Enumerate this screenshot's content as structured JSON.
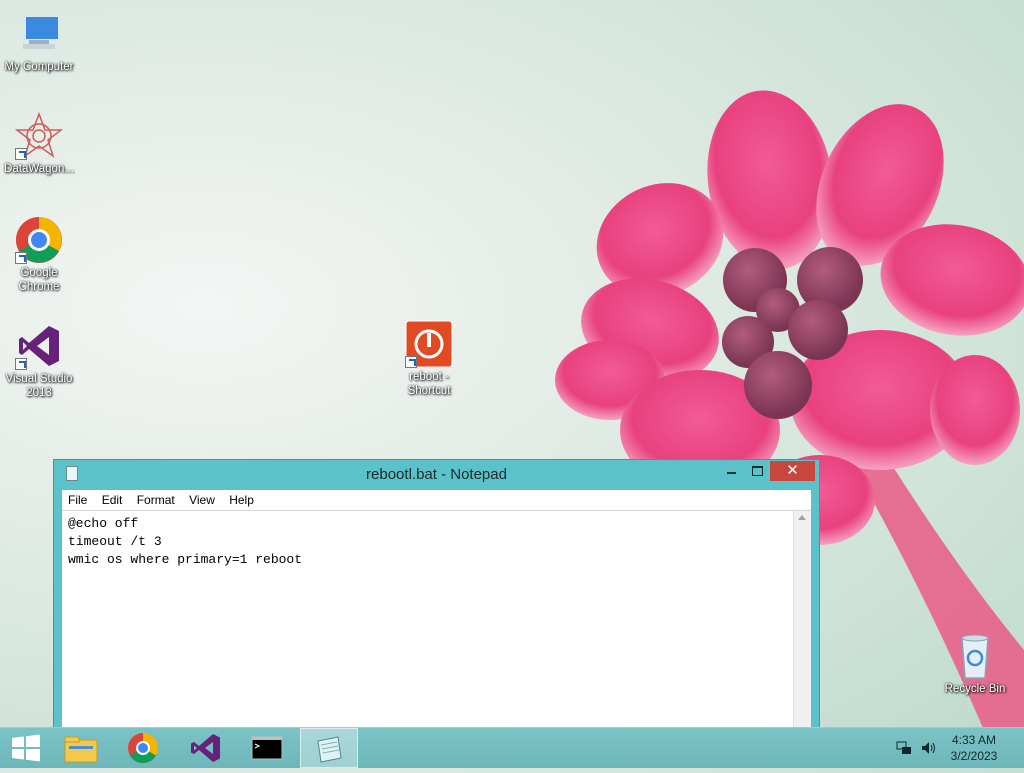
{
  "desktop": {
    "icons": [
      {
        "label": "My Computer",
        "icon": "computer-icon"
      },
      {
        "label": "DataWagon...",
        "icon": "datawagon-icon"
      },
      {
        "label": "Google Chrome",
        "icon": "chrome-icon"
      },
      {
        "label": "Visual Studio 2013",
        "icon": "visual-studio-icon"
      },
      {
        "label": "reboot - Shortcut",
        "icon": "power-icon"
      },
      {
        "label": "Recycle Bin",
        "icon": "recycle-bin-icon"
      }
    ]
  },
  "notepad": {
    "title": "rebootl.bat - Notepad",
    "close_glyph": "✕",
    "menu": [
      "File",
      "Edit",
      "Format",
      "View",
      "Help"
    ],
    "content": "@echo off\ntimeout /t 3\nwmic os where primary=1 reboot"
  },
  "taskbar": {
    "items": [
      "start-icon",
      "file-explorer-icon",
      "chrome-icon",
      "visual-studio-icon",
      "command-prompt-icon",
      "notepad-icon"
    ],
    "clock": {
      "time": "4:33 AM",
      "date": "3/2/2023"
    }
  },
  "colors": {
    "accent": "#5ac2c8",
    "close": "#c7463e",
    "flower": "#e8417e"
  }
}
